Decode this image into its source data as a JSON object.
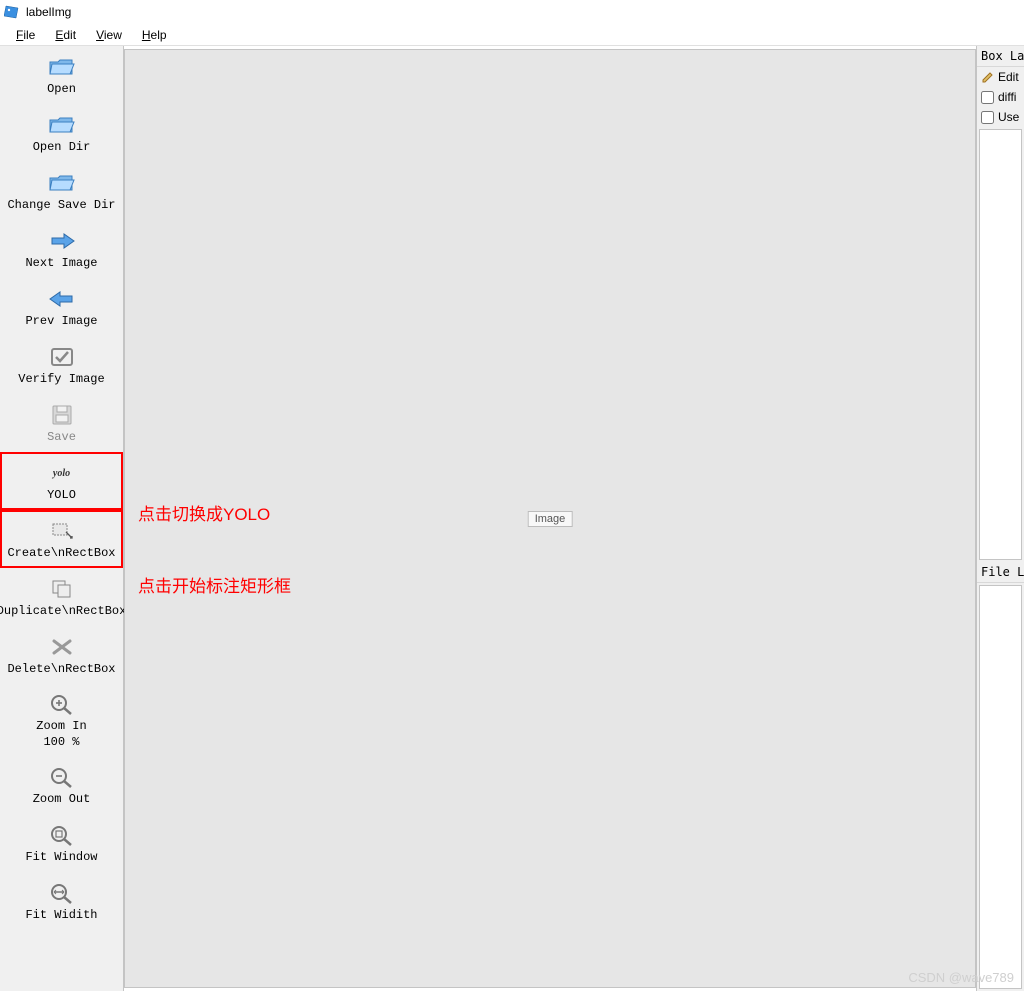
{
  "app": {
    "title": "labelImg"
  },
  "menu": {
    "file": "File",
    "edit": "Edit",
    "view": "View",
    "help": "Help"
  },
  "toolbar": {
    "open": "Open",
    "open_dir": "Open Dir",
    "change_save_dir": "Change Save Dir",
    "next_image": "Next Image",
    "prev_image": "Prev Image",
    "verify_image": "Verify Image",
    "save": "Save",
    "yolo_icon_text": "yolo",
    "yolo": "YOLO",
    "create_rect": "Create\\nRectBox",
    "duplicate_rect": "Duplicate\\nRectBox",
    "delete_rect": "Delete\\nRectBox",
    "zoom_in": "Zoom In",
    "zoom_level": "100 %",
    "zoom_out": "Zoom Out",
    "fit_window": "Fit Window",
    "fit_width": "Fit Widith"
  },
  "canvas": {
    "placeholder": "Image"
  },
  "right_panel": {
    "box_labels_header": "Box Labe",
    "edit_label": "Edit",
    "difficult": "diffi",
    "use_default": "Use",
    "file_list_header": "File Lis"
  },
  "annotations": {
    "yolo_note": "点击切换成YOLO",
    "rect_note": "点击开始标注矩形框"
  },
  "watermark": "CSDN @wave789"
}
